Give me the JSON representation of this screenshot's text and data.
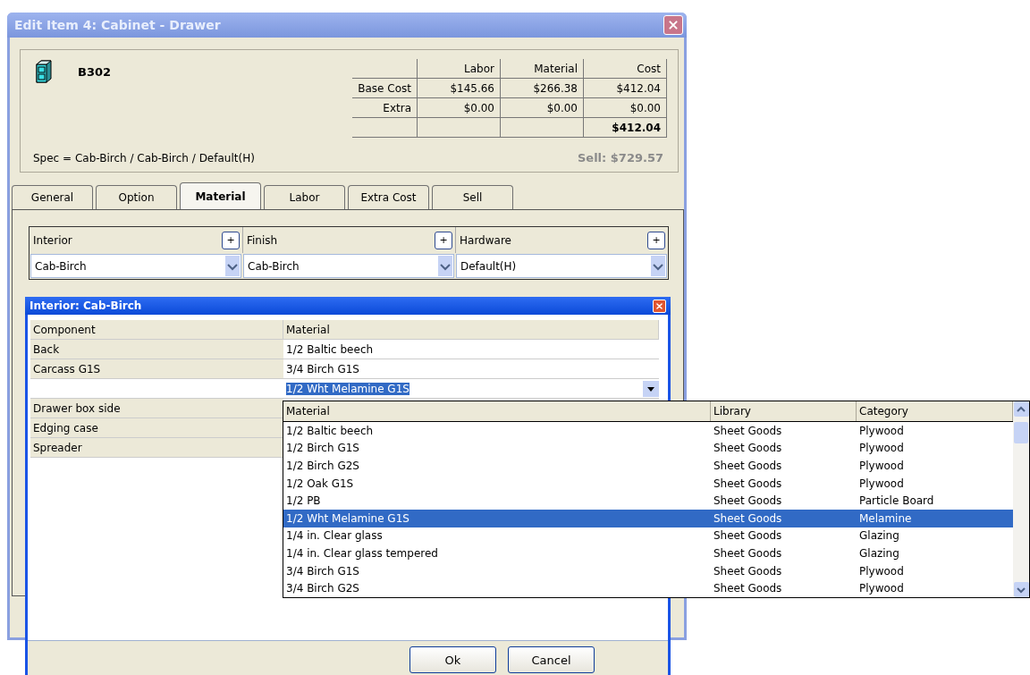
{
  "window": {
    "title": "Edit Item 4: Cabinet - Drawer"
  },
  "item": {
    "code": "B302",
    "spec": "Spec = Cab-Birch / Cab-Birch / Default(H)",
    "sell": "Sell: $729.57"
  },
  "cost_table": {
    "columns": [
      "Labor",
      "Material",
      "Cost"
    ],
    "rows": [
      {
        "label": "Base Cost",
        "cells": [
          "$145.66",
          "$266.38",
          "$412.04"
        ]
      },
      {
        "label": "Extra",
        "cells": [
          "$0.00",
          "$0.00",
          "$0.00"
        ]
      }
    ],
    "total": "$412.04"
  },
  "tabs": [
    {
      "label": "General",
      "selected": false
    },
    {
      "label": "Option",
      "selected": false
    },
    {
      "label": "Material",
      "selected": true
    },
    {
      "label": "Labor",
      "selected": false
    },
    {
      "label": "Extra Cost",
      "selected": false
    },
    {
      "label": "Sell",
      "selected": false
    }
  ],
  "material_slots": [
    {
      "label": "Interior",
      "add": "+",
      "value": "Cab-Birch"
    },
    {
      "label": "Finish",
      "add": "+",
      "value": "Cab-Birch"
    },
    {
      "label": "Hardware",
      "add": "+",
      "value": "Default(H)"
    }
  ],
  "interior_dialog": {
    "title": "Interior: Cab-Birch",
    "columns": [
      "Component",
      "Material"
    ],
    "rows": [
      {
        "kind": "plain",
        "component": "Back",
        "material": "1/2 Baltic beech"
      },
      {
        "kind": "plain",
        "component": "Carcass G1S",
        "material": "3/4 Birch G1S"
      },
      {
        "kind": "editing",
        "material": "1/2 Wht Melamine G1S"
      },
      {
        "kind": "covered",
        "component": "Drawer box side"
      },
      {
        "kind": "covered",
        "component": "Edging case"
      },
      {
        "kind": "covered",
        "component": "Spreader"
      }
    ],
    "buttons": [
      "Ok",
      "Cancel"
    ]
  },
  "dropdown": {
    "columns": [
      "Material",
      "Library",
      "Category"
    ],
    "rows": [
      {
        "material": "1/2 Baltic beech",
        "library": "Sheet Goods",
        "category": "Plywood",
        "selected": false
      },
      {
        "material": "1/2 Birch G1S",
        "library": "Sheet Goods",
        "category": "Plywood",
        "selected": false
      },
      {
        "material": "1/2 Birch G2S",
        "library": "Sheet Goods",
        "category": "Plywood",
        "selected": false
      },
      {
        "material": "1/2 Oak G1S",
        "library": "Sheet Goods",
        "category": "Plywood",
        "selected": false
      },
      {
        "material": "1/2 PB",
        "library": "Sheet Goods",
        "category": "Particle Board",
        "selected": false
      },
      {
        "material": "1/2 Wht Melamine G1S",
        "library": "Sheet Goods",
        "category": "Melamine",
        "selected": true
      },
      {
        "material": "1/4 in. Clear glass",
        "library": "Sheet Goods",
        "category": "Glazing",
        "selected": false
      },
      {
        "material": "1/4 in. Clear glass tempered",
        "library": "Sheet Goods",
        "category": "Glazing",
        "selected": false
      },
      {
        "material": "3/4 Birch G1S",
        "library": "Sheet Goods",
        "category": "Plywood",
        "selected": false
      },
      {
        "material": "3/4 Birch G2S",
        "library": "Sheet Goods",
        "category": "Plywood",
        "selected": false
      }
    ]
  }
}
